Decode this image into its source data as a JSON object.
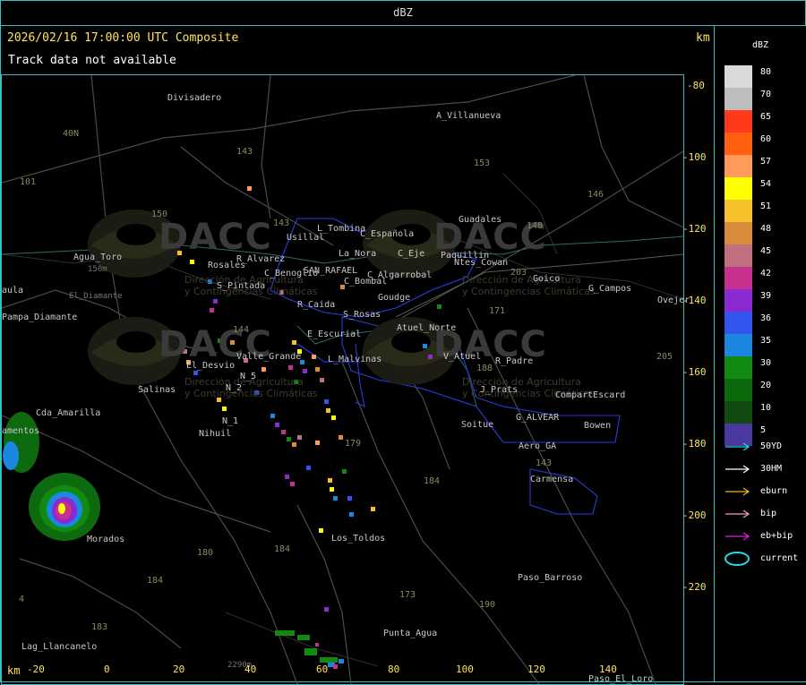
{
  "header": {
    "product": "dBZ",
    "timestamp": "2026/02/16 17:00:00 UTC Composite",
    "track_notice": "Track data not available",
    "km_right": "km",
    "km_bottom": "km"
  },
  "axes": {
    "x_ticks": [
      "-20",
      "0",
      "20",
      "40",
      "60",
      "80",
      "100",
      "120",
      "140"
    ],
    "y_ticks": [
      "-80",
      "-100",
      "-120",
      "-140",
      "-160",
      "-180",
      "-200",
      "-220"
    ]
  },
  "places": [
    "Divisadero",
    "A_Villanueva",
    "Agua_Toro",
    "aula",
    "Pampa_Diamante",
    "El_Diamante",
    "L_Tombina",
    "Usillal",
    "C_Española",
    "C_Eje",
    "Paquillin",
    "Ntes_Cowan",
    "La_Nora",
    "Rosales",
    "C_Benoglio",
    "SAN_RAFAEL",
    "R_Alvarez",
    "C_Algarrobal",
    "S_Pintada",
    "C_Bombal",
    "Goudge",
    "Guadales",
    "Goico",
    "G_Campos",
    "Ovejer",
    "R_Caida",
    "S_Rosas",
    "Atuel_Norte",
    "E_Escurial",
    "Valle_Grande",
    "L_Malvinas",
    "El_Desvio",
    "N_5",
    "N_2",
    "Salinas",
    "V_Atuel",
    "R_Padre",
    "J_Prats",
    "CompartEscard",
    "G_ALVEAR",
    "Soitue",
    "Bowen",
    "Aero_GA",
    "Carmensa",
    "Cda_Amarilla",
    "N_1",
    "Nihuil",
    "amentos",
    "Morados",
    "Los_Toldos",
    "Paso_Barroso",
    "Punta_Agua",
    "Lag_Llancanelo",
    "Paso_El_Loro",
    "150m",
    "2290m"
  ],
  "roads": [
    "143",
    "40N",
    "101",
    "150",
    "153",
    "146",
    "148",
    "203",
    "171",
    "143",
    "144",
    "188",
    "205",
    "179",
    "184",
    "180",
    "184",
    "173",
    "190",
    "184",
    "183",
    "143",
    "4"
  ],
  "watermark": {
    "brand": "DACC",
    "org_line1": "Dirección de Agricultura",
    "org_line2": "y Contingencias Climáticas"
  },
  "legend": {
    "title": "dBZ",
    "levels": [
      {
        "label": "80",
        "color": "#d9d9d9"
      },
      {
        "label": "70",
        "color": "#bdbdbd"
      },
      {
        "label": "65",
        "color": "#ff3a1a"
      },
      {
        "label": "60",
        "color": "#ff5f0f"
      },
      {
        "label": "57",
        "color": "#ff9a5a"
      },
      {
        "label": "54",
        "color": "#ffff00"
      },
      {
        "label": "51",
        "color": "#f5c02a"
      },
      {
        "label": "48",
        "color": "#d98c3a"
      },
      {
        "label": "45",
        "color": "#c07080"
      },
      {
        "label": "42",
        "color": "#c83090"
      },
      {
        "label": "39",
        "color": "#8a2ad0"
      },
      {
        "label": "36",
        "color": "#3355ee"
      },
      {
        "label": "35",
        "color": "#1a88e0"
      },
      {
        "label": "30",
        "color": "#128a12"
      },
      {
        "label": "20",
        "color": "#0b6a0b"
      },
      {
        "label": "10",
        "color": "#104a10"
      },
      {
        "label": "5",
        "color": "#4a3aa0"
      }
    ],
    "tracks": [
      {
        "label": "50YD",
        "color": "#22d8e8"
      },
      {
        "label": "30HM",
        "color": "#ffffff"
      },
      {
        "label": "eburn",
        "color": "#f0b030"
      },
      {
        "label": "bip",
        "color": "#f0a0c0"
      },
      {
        "label": "eb+bip",
        "color": "#e020e0"
      },
      {
        "label": "current",
        "color": "#22d8e8"
      }
    ]
  }
}
